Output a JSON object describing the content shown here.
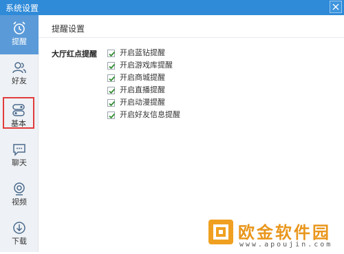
{
  "window": {
    "title": "系统设置"
  },
  "sidebar": {
    "items": [
      {
        "label": "提醒",
        "icon": "alarm-clock-icon",
        "active": true
      },
      {
        "label": "好友",
        "icon": "friends-icon"
      },
      {
        "label": "基本",
        "icon": "toggle-icon",
        "highlighted": true
      },
      {
        "label": "聊天",
        "icon": "chat-icon"
      },
      {
        "label": "视频",
        "icon": "camera-icon"
      },
      {
        "label": "下载",
        "icon": "download-icon"
      }
    ]
  },
  "main": {
    "header": "提醒设置",
    "group_label": "大厅红点提醒",
    "options": [
      {
        "label": "开启蓝钻提醒",
        "checked": true
      },
      {
        "label": "开启游戏库提醒",
        "checked": true
      },
      {
        "label": "开启商城提醒",
        "checked": true
      },
      {
        "label": "开启直播提醒",
        "checked": true
      },
      {
        "label": "开启动漫提醒",
        "checked": true
      },
      {
        "label": "开启好友信息提醒",
        "checked": true
      }
    ]
  },
  "watermark": {
    "brand": "欧金软件园",
    "url": "www.apoujin.com"
  },
  "colors": {
    "titlebar": "#2f8ad8",
    "active_nav": "#5a9ad8",
    "highlight_border": "#e23b3b",
    "check": "#2e8b2e"
  }
}
